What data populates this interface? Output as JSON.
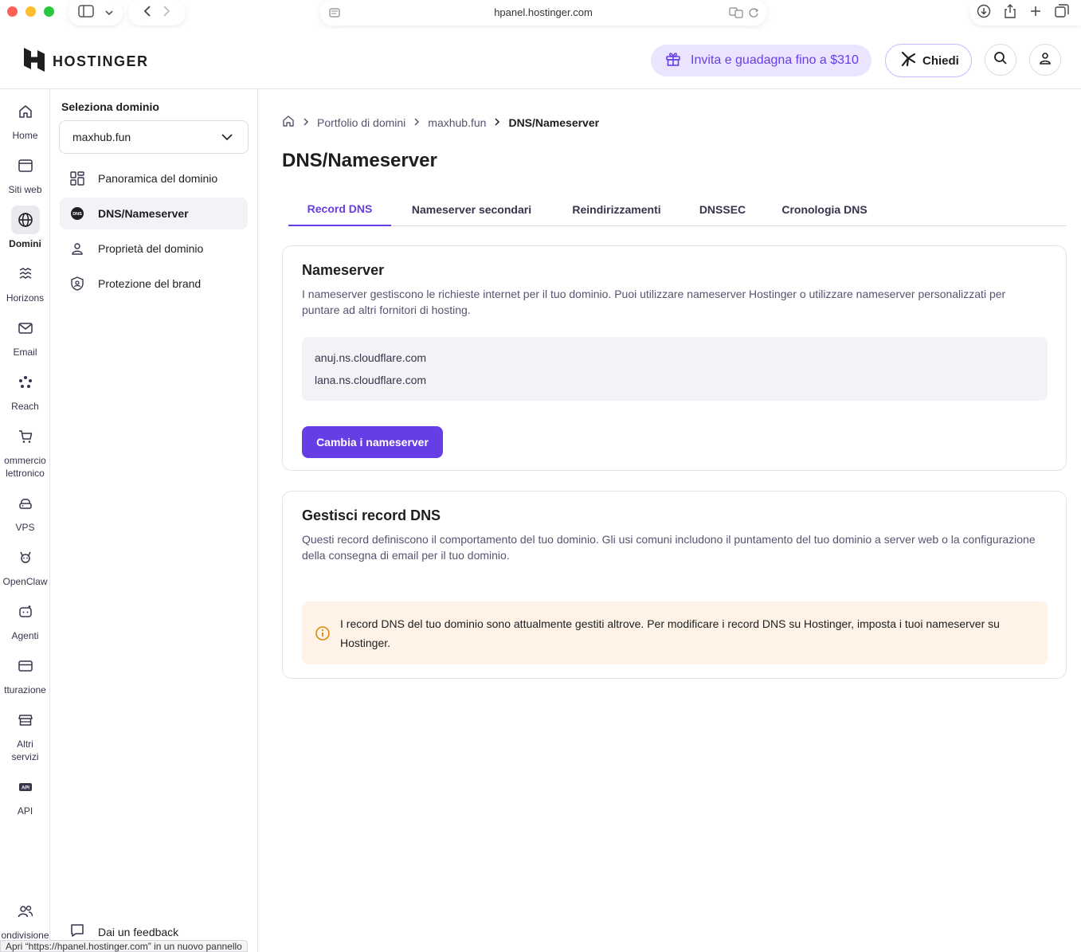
{
  "browser": {
    "url": "hpanel.hostinger.com"
  },
  "header": {
    "logo_text": "HOSTINGER",
    "invite_label": "Invita e guadagna fino a $310",
    "ask_label": "Chiedi"
  },
  "rail": {
    "items": [
      {
        "label": "Home",
        "icon": "home-icon"
      },
      {
        "label": "Siti web",
        "icon": "browser-window-icon"
      },
      {
        "label": "Domini",
        "icon": "globe-icon",
        "active": true
      },
      {
        "label": "Horizons",
        "icon": "horizons-icon"
      },
      {
        "label": "Email",
        "icon": "mail-icon"
      },
      {
        "label": "Reach",
        "icon": "reach-icon"
      },
      {
        "label": "ommercio\nlettronico",
        "icon": "cart-icon"
      },
      {
        "label": "VPS",
        "icon": "cloud-server-icon"
      },
      {
        "label": "OpenClaw",
        "icon": "openclaw-icon"
      },
      {
        "label": "Agenti",
        "icon": "agent-icon"
      },
      {
        "label": "tturazione",
        "icon": "credit-card-icon"
      },
      {
        "label": "Altri\nservizi",
        "icon": "store-icon"
      },
      {
        "label": "API",
        "icon": "api-icon"
      },
      {
        "label": "ondivisione",
        "icon": "users-icon"
      }
    ]
  },
  "sidebar": {
    "select_label": "Seleziona dominio",
    "selected_domain": "maxhub.fun",
    "items": [
      {
        "label": "Panoramica del dominio",
        "icon": "grid-icon"
      },
      {
        "label": "DNS/Nameserver",
        "icon": "dns-icon",
        "active": true
      },
      {
        "label": "Proprietà del dominio",
        "icon": "person-icon"
      },
      {
        "label": "Protezione del brand",
        "icon": "shield-icon"
      }
    ],
    "feedback_label": "Dai un feedback"
  },
  "breadcrumb": {
    "items": [
      "Portfolio di domini",
      "maxhub.fun",
      "DNS/Nameserver"
    ]
  },
  "page": {
    "title": "DNS/Nameserver"
  },
  "tabs": [
    {
      "label": "Record DNS",
      "active": true
    },
    {
      "label": "Nameserver secondari"
    },
    {
      "label": "Reindirizzamenti"
    },
    {
      "label": "DNSSEC"
    },
    {
      "label": "Cronologia DNS"
    }
  ],
  "nameserver_card": {
    "title": "Nameserver",
    "description": "I nameserver gestiscono le richieste internet per il tuo dominio. Puoi utilizzare nameserver Hostinger o utilizzare nameserver personalizzati per puntare ad altri fornitori di hosting.",
    "nameservers": [
      "anuj.ns.cloudflare.com",
      "lana.ns.cloudflare.com"
    ],
    "button_label": "Cambia i nameserver"
  },
  "dns_card": {
    "title": "Gestisci record DNS",
    "description": "Questi record definiscono il comportamento del tuo dominio. Gli usi comuni includono il puntamento del tuo dominio a server web o la configurazione della consegna di email per il tuo dominio.",
    "alert_text": "I record DNS del tuo dominio sono attualmente gestiti altrove. Per modificare i record DNS su Hostinger, imposta i tuoi nameserver su Hostinger."
  },
  "status_bar": {
    "text": "Apri “https://hpanel.hostinger.com” in un nuovo pannello"
  },
  "colors": {
    "accent": "#673de6",
    "alert_bg": "#fef3e6",
    "alert_icon": "#d98b00"
  }
}
